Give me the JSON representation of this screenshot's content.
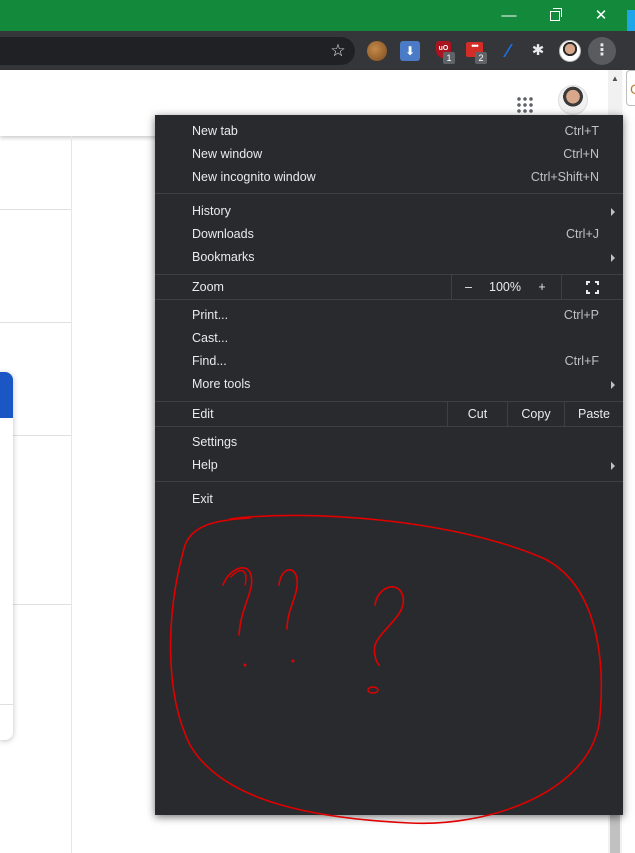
{
  "window": {
    "minimize_glyph": "—",
    "close_glyph": "✕",
    "accent": "#138a3b"
  },
  "toolbar": {
    "bookmark_star": "☆",
    "extensions": [
      {
        "name": "squirrel-extension-icon"
      },
      {
        "name": "download-extension-icon"
      },
      {
        "name": "ublock-origin-icon",
        "badge": "1"
      },
      {
        "name": "lastpass-icon",
        "badge": "2"
      },
      {
        "name": "feather-extension-icon"
      },
      {
        "name": "puzzle-extensions-icon",
        "glyph": "✱"
      }
    ],
    "menu_glyph": "⋮"
  },
  "page": {
    "avatar_edge_text": "C"
  },
  "menu": {
    "group1": [
      {
        "label": "New tab",
        "shortcut": "Ctrl+T"
      },
      {
        "label": "New window",
        "shortcut": "Ctrl+N"
      },
      {
        "label": "New incognito window",
        "shortcut": "Ctrl+Shift+N"
      }
    ],
    "group2": [
      {
        "label": "History",
        "submenu": true
      },
      {
        "label": "Downloads",
        "shortcut": "Ctrl+J"
      },
      {
        "label": "Bookmarks",
        "submenu": true
      }
    ],
    "zoom": {
      "label": "Zoom",
      "minus": "–",
      "value": "100%",
      "plus": "+"
    },
    "group3": [
      {
        "label": "Print...",
        "shortcut": "Ctrl+P"
      },
      {
        "label": "Cast..."
      },
      {
        "label": "Find...",
        "shortcut": "Ctrl+F"
      },
      {
        "label": "More tools",
        "submenu": true
      }
    ],
    "edit": {
      "label": "Edit",
      "cut": "Cut",
      "copy": "Copy",
      "paste": "Paste"
    },
    "group4": [
      {
        "label": "Settings"
      },
      {
        "label": "Help",
        "submenu": true
      }
    ],
    "exit": {
      "label": "Exit"
    }
  },
  "annotation": {
    "ink_color": "#e00000",
    "scribble_text": "?? ?"
  }
}
